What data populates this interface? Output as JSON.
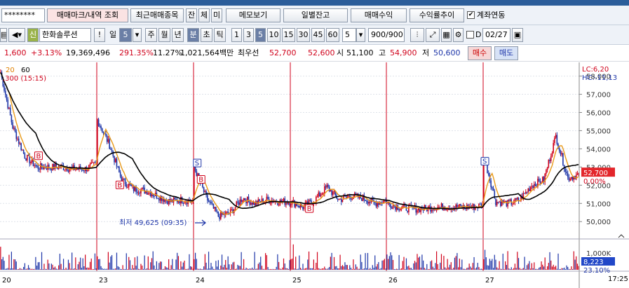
{
  "toolbar1": {
    "account_mask": "********",
    "trade_mark_button": "매매마크/내역 조회",
    "recent_items_button": "최근매매종목",
    "small_buttons": [
      "잔",
      "체",
      "미"
    ],
    "memo_button": "메모보기",
    "daily_balance_button": "일별잔고",
    "trade_profit_button": "매매수익",
    "return_trend_button": "수익률추이",
    "account_link_label": "계좌연동",
    "account_link_checked": true
  },
  "toolbar2": {
    "credit_badge": "신",
    "stock_name": "한화솔루션",
    "excl_button": "!",
    "period_unit": "일",
    "period_value": "5",
    "periods": [
      "주",
      "월",
      "년",
      "분",
      "초",
      "틱"
    ],
    "intervals": [
      "1",
      "3",
      "5",
      "10",
      "15",
      "30",
      "45",
      "60"
    ],
    "interval_selected": "5",
    "count_select": "5",
    "count_display": "900/900",
    "date_value": "02/27"
  },
  "quote": {
    "change": "1,600",
    "change_pct": "+3.13%",
    "volume": "19,369,496",
    "volume_ratio": "291.35%",
    "turnover": "11.27%",
    "amount": "1,021,564백만",
    "best_label": "최우선",
    "best_ask": "52,700",
    "best_bid": "52,600",
    "open_label": "시",
    "open": "51,100",
    "high_label": "고",
    "high": "54,900",
    "low_label": "저",
    "low": "50,600",
    "buy_button": "매수",
    "sell_button": "매도"
  },
  "chart_data": {
    "type": "candlestick",
    "top_left_labels": [
      "20",
      "60"
    ],
    "top_left_info": ",300 (15:15)",
    "lc_label": "LC:6,20",
    "hc_label": "HC:-11,13",
    "y_ticks": [
      58000,
      57000,
      56000,
      55000,
      54000,
      53000,
      52000,
      51000,
      50000
    ],
    "ylim": [
      49200,
      58600
    ],
    "current_price": "52,700",
    "current_pct": "0.00%",
    "volume_labels": [
      "1,000K",
      "8,223",
      "23.10%"
    ],
    "x_labels": [
      "20",
      "23",
      "24",
      "25",
      "26",
      "27"
    ],
    "time_label": "17:25:00",
    "min_annotation": "최저 49,625 (09:35)",
    "markers": [
      {
        "kind": "B",
        "day": 0,
        "pos": 0.38,
        "price": 53600
      },
      {
        "kind": "B",
        "day": 1,
        "pos": 0.22,
        "price": 52000
      },
      {
        "kind": "S",
        "day": 2,
        "pos": 0.02,
        "price": 53200
      },
      {
        "kind": "B",
        "day": 2,
        "pos": 0.06,
        "price": 52300
      },
      {
        "kind": "B",
        "day": 3,
        "pos": 0.18,
        "price": 50700
      },
      {
        "kind": "S",
        "day": 5,
        "pos": 0.0,
        "price": 53300
      }
    ],
    "daily_close_anchor": [
      [
        58200,
        55200,
        53600,
        53000,
        53000,
        53000,
        52900,
        52900,
        53200
      ],
      [
        55600,
        54200,
        52300,
        51800,
        51700,
        51400,
        51100,
        51200,
        51100
      ],
      [
        53000,
        51300,
        50300,
        50500,
        51300,
        51000,
        51200,
        51100,
        51100
      ],
      [
        51100,
        50800,
        51200,
        51900,
        51200,
        51400,
        51300,
        51000,
        51200
      ],
      [
        51000,
        50800,
        50700,
        50700,
        50800,
        50800,
        50800,
        50800,
        50900
      ],
      [
        53600,
        51100,
        51000,
        51200,
        52000,
        52300,
        54700,
        52400,
        52600
      ]
    ]
  }
}
